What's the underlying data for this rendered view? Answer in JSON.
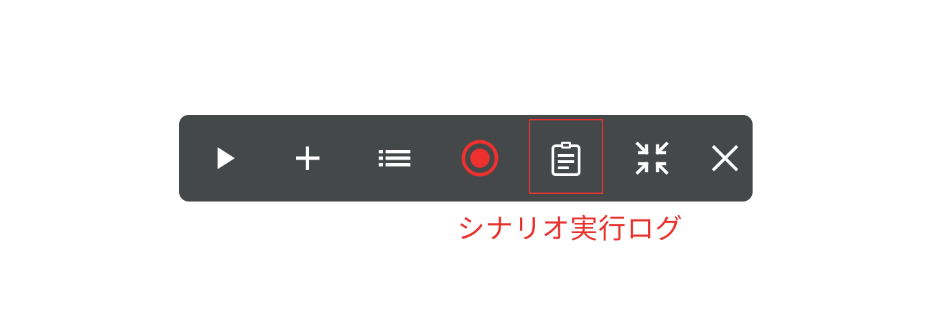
{
  "toolbar": {
    "background_color": "#454849",
    "icon_color": "#ffffff",
    "accent_color": "#f0302f",
    "buttons": [
      {
        "name": "play-icon"
      },
      {
        "name": "plus-icon"
      },
      {
        "name": "list-icon"
      },
      {
        "name": "record-icon"
      },
      {
        "name": "clipboard-icon"
      },
      {
        "name": "collapse-icon"
      },
      {
        "name": "close-icon"
      }
    ]
  },
  "annotation": {
    "label": "シナリオ実行ログ",
    "color": "#e8322e"
  }
}
